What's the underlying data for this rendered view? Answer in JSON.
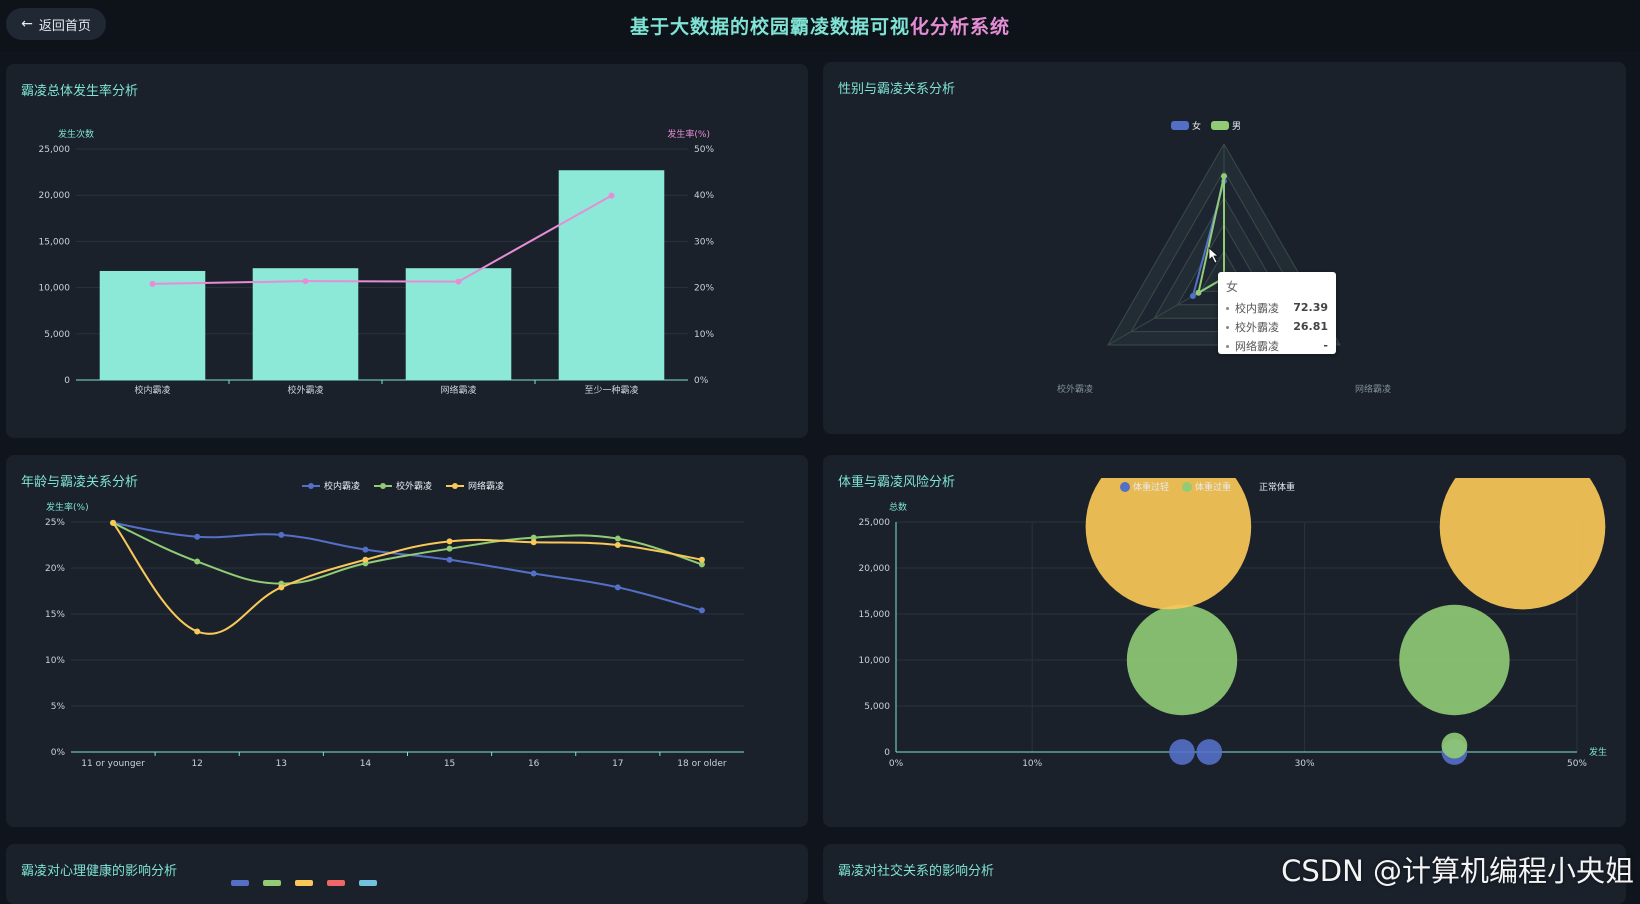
{
  "header": {
    "back_label": "返回首页",
    "title_part1": "基于大数据的校园霸凌数据可视",
    "title_part2": "化分析系统"
  },
  "panels": {
    "p1_title": "霸凌总体发生率分析",
    "p2_title": "性别与霸凌关系分析",
    "p3_title": "年龄与霸凌关系分析",
    "p4_title": "体重与霸凌风险分析",
    "p5_title": "霸凌对心理健康的影响分析",
    "p6_title": "霸凌对社交关系的影响分析"
  },
  "tooltip": {
    "title": "女",
    "rows": [
      {
        "label": "校内霸凌",
        "value": "72.39"
      },
      {
        "label": "校外霸凌",
        "value": "26.81"
      },
      {
        "label": "网络霸凌",
        "value": "-"
      }
    ]
  },
  "watermark": "CSDN @计算机编程小央姐",
  "colors": {
    "accent": "#7fe3d5",
    "pink": "#e58ed6",
    "blue": "#5470c6",
    "green": "#91cc75",
    "yellow": "#fac858",
    "red": "#ee6666",
    "sky": "#73c0de"
  },
  "chart_data": [
    {
      "type": "bar",
      "title": "霸凌总体发生率分析",
      "categories": [
        "校内霸凌",
        "校外霸凌",
        "网络霸凌",
        "至少一种霸凌"
      ],
      "ylabel": "发生次数",
      "y2label": "发生率(%)",
      "ylim": [
        0,
        25000
      ],
      "y2lim": [
        0,
        50
      ],
      "yticks": [
        "0",
        "5,000",
        "10,000",
        "15,000",
        "20,000",
        "25,000"
      ],
      "y2ticks": [
        "0%",
        "10%",
        "20%",
        "30%",
        "40%",
        "50%"
      ],
      "series": [
        {
          "type": "bar",
          "values": [
            11800,
            12100,
            12100,
            22700
          ]
        },
        {
          "type": "line",
          "values": [
            20.8,
            21.4,
            21.3,
            39.9
          ]
        }
      ],
      "grid": true
    },
    {
      "type": "radar",
      "title": "性别与霸凌关系分析",
      "indicators": [
        "校内霸凌",
        "校外霸凌",
        "网络霸凌"
      ],
      "legend": [
        "女",
        "男"
      ],
      "series": [
        {
          "name": "女",
          "values": [
            72.39,
            26.81,
            null
          ]
        },
        {
          "name": "男",
          "values": [
            76,
            22,
            null
          ]
        }
      ]
    },
    {
      "type": "line",
      "title": "年龄与霸凌关系分析",
      "ylabel": "发生率(%)",
      "categories": [
        "11 or younger",
        "12",
        "13",
        "14",
        "15",
        "16",
        "17",
        "18 or older"
      ],
      "ylim": [
        0,
        25
      ],
      "yticks": [
        "0%",
        "5%",
        "10%",
        "15%",
        "20%",
        "25%"
      ],
      "series": [
        {
          "name": "校内霸凌",
          "values": [
            24.9,
            23.4,
            23.6,
            22.0,
            20.9,
            19.4,
            17.9,
            15.4
          ]
        },
        {
          "name": "校外霸凌",
          "values": [
            24.9,
            20.7,
            18.3,
            20.5,
            22.1,
            23.3,
            23.2,
            20.4
          ]
        },
        {
          "name": "网络霸凌",
          "values": [
            24.9,
            13.1,
            17.9,
            20.9,
            22.9,
            22.8,
            22.5,
            20.9
          ]
        }
      ],
      "legend_position": "top"
    },
    {
      "type": "scatter",
      "title": "体重与霸凌风险分析",
      "ylabel": "总数",
      "xlabel": "发生",
      "xlim": [
        0,
        50
      ],
      "ylim": [
        0,
        25000
      ],
      "xticks": [
        "0%",
        "10%",
        "30%",
        "50%"
      ],
      "yticks": [
        "0",
        "5,000",
        "10,000",
        "15,000",
        "20,000",
        "25,000"
      ],
      "legend": [
        "体重过轻",
        "体重过重",
        "正常体重"
      ],
      "series": [
        {
          "name": "体重过轻",
          "points": [
            [
              21,
              0,
              1400
            ],
            [
              23,
              0,
              1400
            ],
            [
              41,
              0,
              1400
            ]
          ]
        },
        {
          "name": "体重过重",
          "points": [
            [
              21,
              10000,
              6000
            ],
            [
              41,
              10000,
              6000
            ],
            [
              41,
              700,
              1400
            ]
          ]
        },
        {
          "name": "正常体重",
          "points": [
            [
              20,
              24500,
              9000
            ],
            [
              46,
              24500,
              9000
            ]
          ]
        }
      ]
    }
  ]
}
